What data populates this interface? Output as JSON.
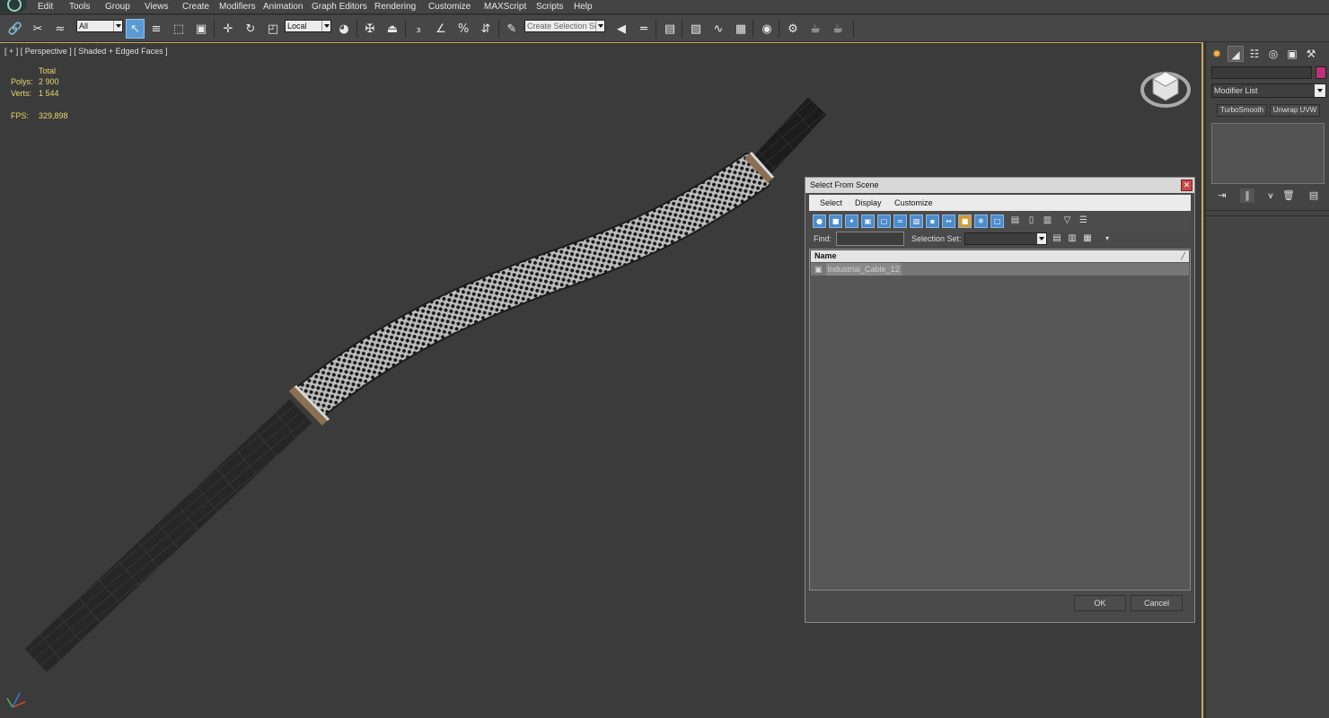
{
  "menubar": {
    "items": [
      "Edit",
      "Tools",
      "Group",
      "Views",
      "Create",
      "Modifiers",
      "Animation",
      "Graph Editors",
      "Rendering",
      "Customize",
      "MAXScript",
      "Scripts",
      "Help"
    ]
  },
  "toolbar": {
    "filter_value": "All",
    "coord_value": "Local",
    "named_selection_placeholder": "Create Selection Se",
    "icons": [
      "select-link-icon",
      "unlink-icon",
      "bind-space-warp-icon",
      "select-object-icon",
      "select-by-name-icon",
      "rect-region-icon",
      "window-crossing-icon",
      "move-icon",
      "rotate-icon",
      "scale-icon",
      "select-manipulate-icon",
      "pivot-center-icon",
      "snap-toggle-icon",
      "angle-snap-icon",
      "percent-snap-icon",
      "spinner-snap-icon",
      "edit-named-sets-icon",
      "mirror-icon",
      "align-icon",
      "layer-manager-icon",
      "graphite-icon",
      "curve-editor-icon",
      "schematic-view-icon",
      "material-editor-icon",
      "render-setup-icon",
      "rendered-frame-icon",
      "render-icon"
    ]
  },
  "viewport": {
    "label": "[ + ] [ Perspective ] [ Shaded + Edged Faces ]",
    "stats_header": "Total",
    "polys_label": "Polys:",
    "polys_value": "2 900",
    "verts_label": "Verts:",
    "verts_value": "1 544",
    "fps_label": "FPS:",
    "fps_value": "329,898"
  },
  "command_panel": {
    "modifier_list": "Modifier List",
    "buttons": [
      "TurboSmooth",
      "Unwrap UVW"
    ],
    "swatch_color": "#c0307a"
  },
  "dialog": {
    "title": "Select From Scene",
    "menus": [
      "Select",
      "Display",
      "Customize"
    ],
    "find_label": "Find:",
    "selection_set_label": "Selection Set:",
    "column_name": "Name",
    "rows": [
      {
        "name": "Industrial_Cable_12"
      }
    ],
    "ok_label": "OK",
    "cancel_label": "Cancel"
  }
}
